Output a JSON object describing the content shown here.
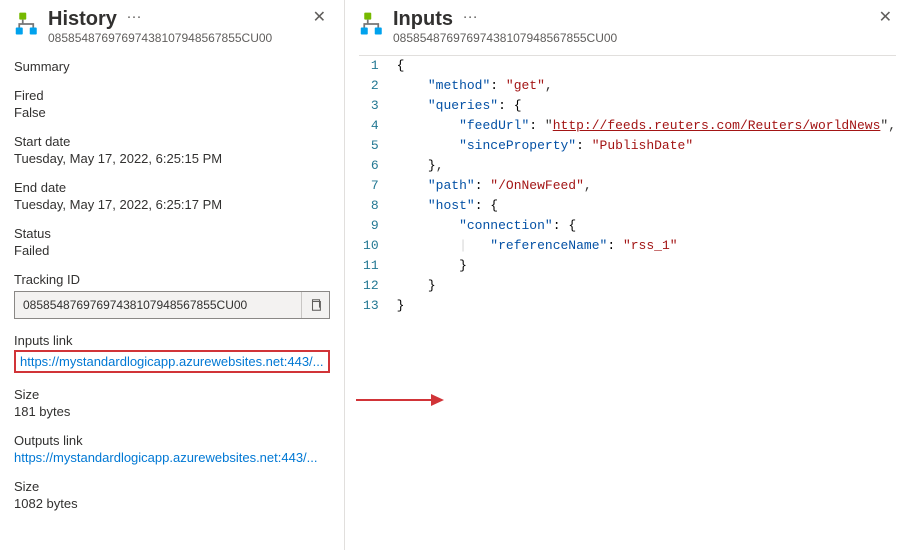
{
  "history": {
    "title": "History",
    "subtitle": "08585487697697438107948567855CU00",
    "summary_label": "Summary",
    "fired_label": "Fired",
    "fired_value": "False",
    "start_label": "Start date",
    "start_value": "Tuesday, May 17, 2022, 6:25:15 PM",
    "end_label": "End date",
    "end_value": "Tuesday, May 17, 2022, 6:25:17 PM",
    "status_label": "Status",
    "status_value": "Failed",
    "tracking_label": "Tracking ID",
    "tracking_value": "08585487697697438107948567855CU00",
    "inputs_link_label": "Inputs link",
    "inputs_link_value": "https://mystandardlogicapp.azurewebsites.net:443/...",
    "inputs_size_label": "Size",
    "inputs_size_value": "181 bytes",
    "outputs_link_label": "Outputs link",
    "outputs_link_value": "https://mystandardlogicapp.azurewebsites.net:443/...",
    "outputs_size_label": "Size",
    "outputs_size_value": "1082 bytes"
  },
  "inputs": {
    "title": "Inputs",
    "subtitle": "08585487697697438107948567855CU00",
    "json": {
      "method": "get",
      "queries": {
        "feedUrl": "http://feeds.reuters.com/Reuters/worldNews",
        "sinceProperty": "PublishDate"
      },
      "path": "/OnNewFeed",
      "host": {
        "connection": {
          "referenceName": "rss_1"
        }
      }
    }
  }
}
